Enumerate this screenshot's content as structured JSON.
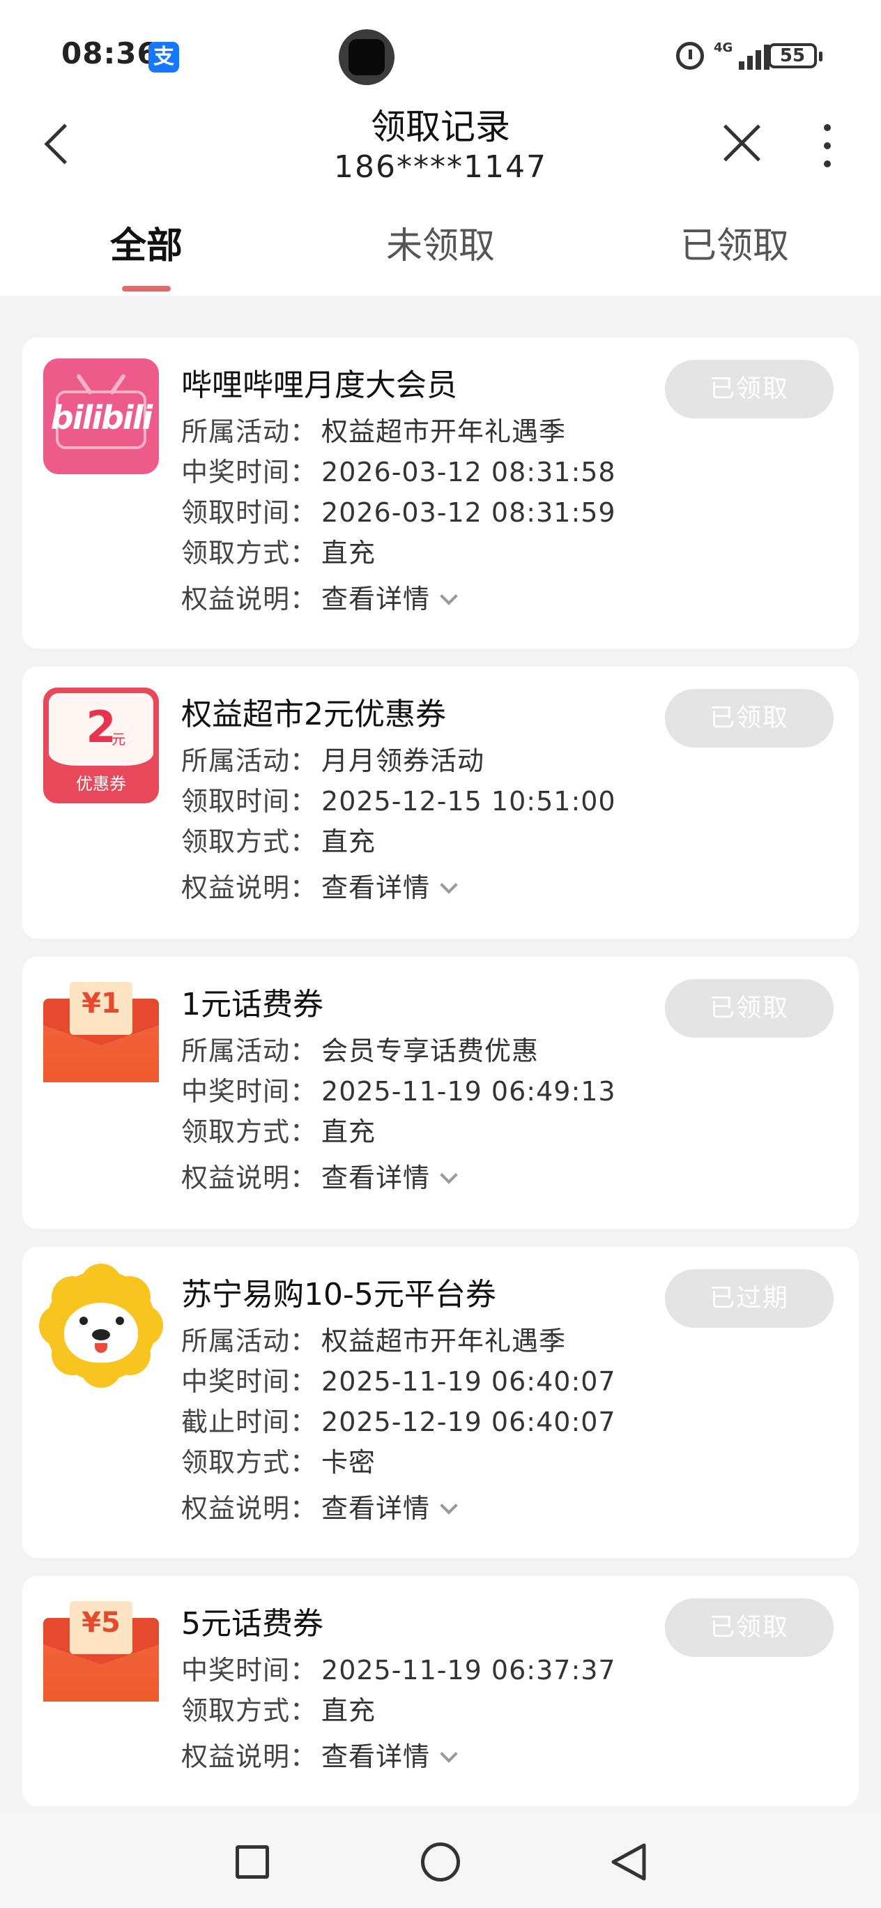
{
  "status_bar": {
    "time": "08:36",
    "app_badge": "支",
    "network": "4G",
    "battery": "55"
  },
  "header": {
    "title": "领取记录",
    "subtitle": "186****1147"
  },
  "tabs": [
    {
      "label": "全部",
      "active": true
    },
    {
      "label": "未领取",
      "active": false
    },
    {
      "label": "已领取",
      "active": false
    }
  ],
  "detail_link": "查看详情",
  "records": [
    {
      "icon": "bilibili-icon",
      "icon_text": "bilibili",
      "title": "哔哩哔哩月度大会员",
      "status": "已领取",
      "rows": [
        {
          "key": "所属活动：",
          "value": "权益超市开年礼遇季"
        },
        {
          "key": "中奖时间：",
          "value": "2026-03-12 08:31:58"
        },
        {
          "key": "领取时间：",
          "value": "2026-03-12 08:31:59"
        },
        {
          "key": "领取方式：",
          "value": "直充"
        },
        {
          "key": "权益说明：",
          "value": "查看详情"
        }
      ]
    },
    {
      "icon": "coupon-icon",
      "icon_num": "2",
      "icon_unit": "元",
      "icon_label": "优惠券",
      "title": "权益超市2元优惠券",
      "status": "已领取",
      "rows": [
        {
          "key": "所属活动：",
          "value": "月月领券活动"
        },
        {
          "key": "领取时间：",
          "value": "2025-12-15 10:51:00"
        },
        {
          "key": "领取方式：",
          "value": "直充"
        },
        {
          "key": "权益说明：",
          "value": "查看详情"
        }
      ]
    },
    {
      "icon": "red-envelope-icon",
      "icon_amount": "¥1",
      "title": "1元话费券",
      "status": "已领取",
      "rows": [
        {
          "key": "所属活动：",
          "value": "会员专享话费优惠"
        },
        {
          "key": "中奖时间：",
          "value": "2025-11-19 06:49:13"
        },
        {
          "key": "领取方式：",
          "value": "直充"
        },
        {
          "key": "权益说明：",
          "value": "查看详情"
        }
      ]
    },
    {
      "icon": "suning-icon",
      "title": "苏宁易购10-5元平台券",
      "status": "已过期",
      "rows": [
        {
          "key": "所属活动：",
          "value": "权益超市开年礼遇季"
        },
        {
          "key": "中奖时间：",
          "value": "2025-11-19 06:40:07"
        },
        {
          "key": "截止时间：",
          "value": "2025-12-19 06:40:07"
        },
        {
          "key": "领取方式：",
          "value": "卡密"
        },
        {
          "key": "权益说明：",
          "value": "查看详情"
        }
      ]
    },
    {
      "icon": "red-envelope-icon",
      "icon_amount": "¥5",
      "title": "5元话费券",
      "status": "已领取",
      "rows": [
        {
          "key": "中奖时间：",
          "value": "2025-11-19 06:37:37"
        },
        {
          "key": "领取方式：",
          "value": "直充"
        },
        {
          "key": "权益说明：",
          "value": "查看详情"
        }
      ]
    }
  ]
}
